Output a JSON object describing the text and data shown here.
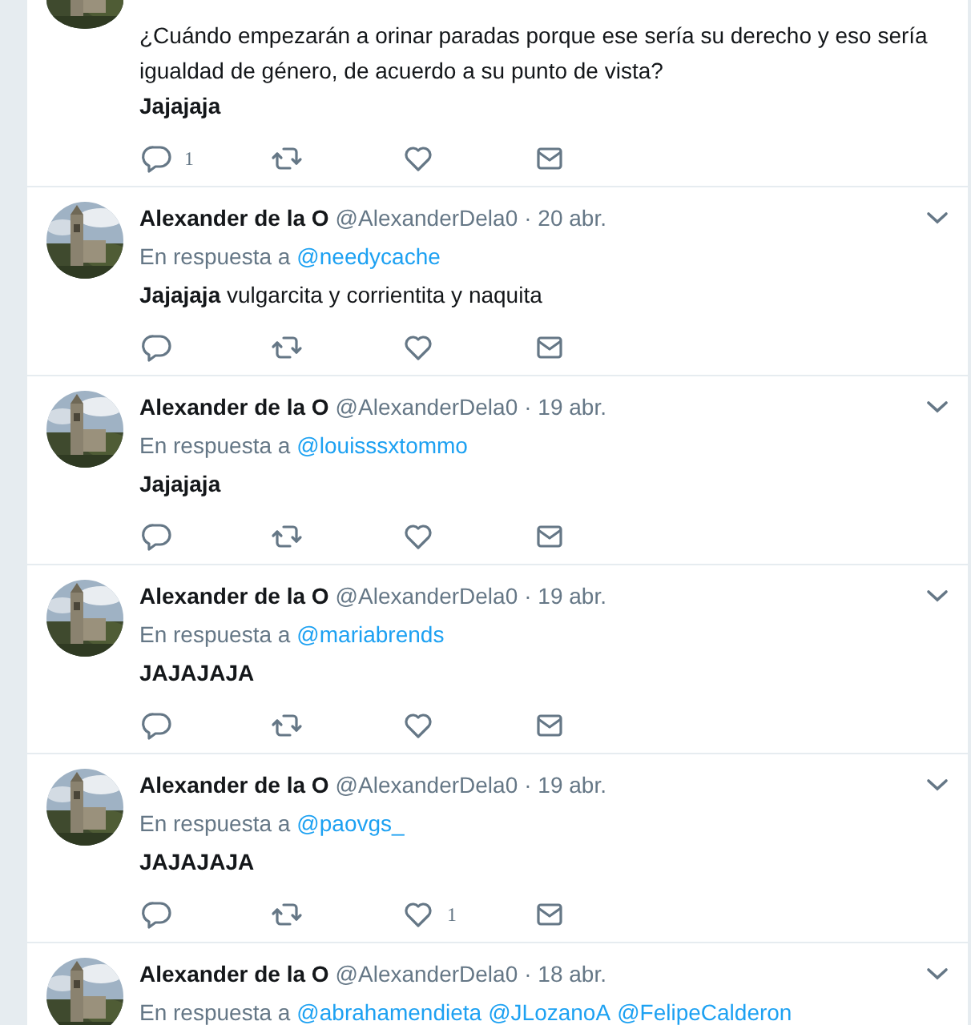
{
  "tweets": [
    {
      "kind": "partial",
      "lines": [
        {
          "text": "¿Cuándo empezarán a orinar paradas porque ese sería su derecho y eso sería igualdad de género, de acuerdo a su punto de vista?",
          "bold": false
        },
        {
          "text": "Jajajaja",
          "bold": true
        }
      ],
      "actions": {
        "reply_count": "1"
      }
    },
    {
      "kind": "full",
      "name": "Alexander de la O",
      "handle": "@AlexanderDela0",
      "date": "· 20 abr.",
      "reply_label": "En respuesta a",
      "mentions": [
        "@needycache"
      ],
      "lines": [
        {
          "text": "**Jajajaja** vulgarcita y corrientita y naquita",
          "bold": false
        }
      ]
    },
    {
      "kind": "full",
      "name": "Alexander de la O",
      "handle": "@AlexanderDela0",
      "date": "· 19 abr.",
      "reply_label": "En respuesta a",
      "mentions": [
        "@louisssxtommo"
      ],
      "lines": [
        {
          "text": "Jajajaja",
          "bold": true
        }
      ]
    },
    {
      "kind": "full",
      "name": "Alexander de la O",
      "handle": "@AlexanderDela0",
      "date": "· 19 abr.",
      "reply_label": "En respuesta a",
      "mentions": [
        "@mariabrends"
      ],
      "lines": [
        {
          "text": "JAJAJAJA",
          "bold": true
        }
      ]
    },
    {
      "kind": "full",
      "name": "Alexander de la O",
      "handle": "@AlexanderDela0",
      "date": "· 19 abr.",
      "reply_label": "En respuesta a",
      "mentions": [
        "@paovgs_"
      ],
      "lines": [
        {
          "text": "JAJAJAJA",
          "bold": true
        }
      ],
      "actions": {
        "like_count": "1"
      }
    },
    {
      "kind": "cut",
      "name": "Alexander de la O",
      "handle": "@AlexanderDela0",
      "date": "· 18 abr.",
      "reply_label": "En respuesta a",
      "mentions": [
        "@abrahamendieta",
        "@JLozanoA",
        "@FelipeCalderon"
      ]
    }
  ]
}
